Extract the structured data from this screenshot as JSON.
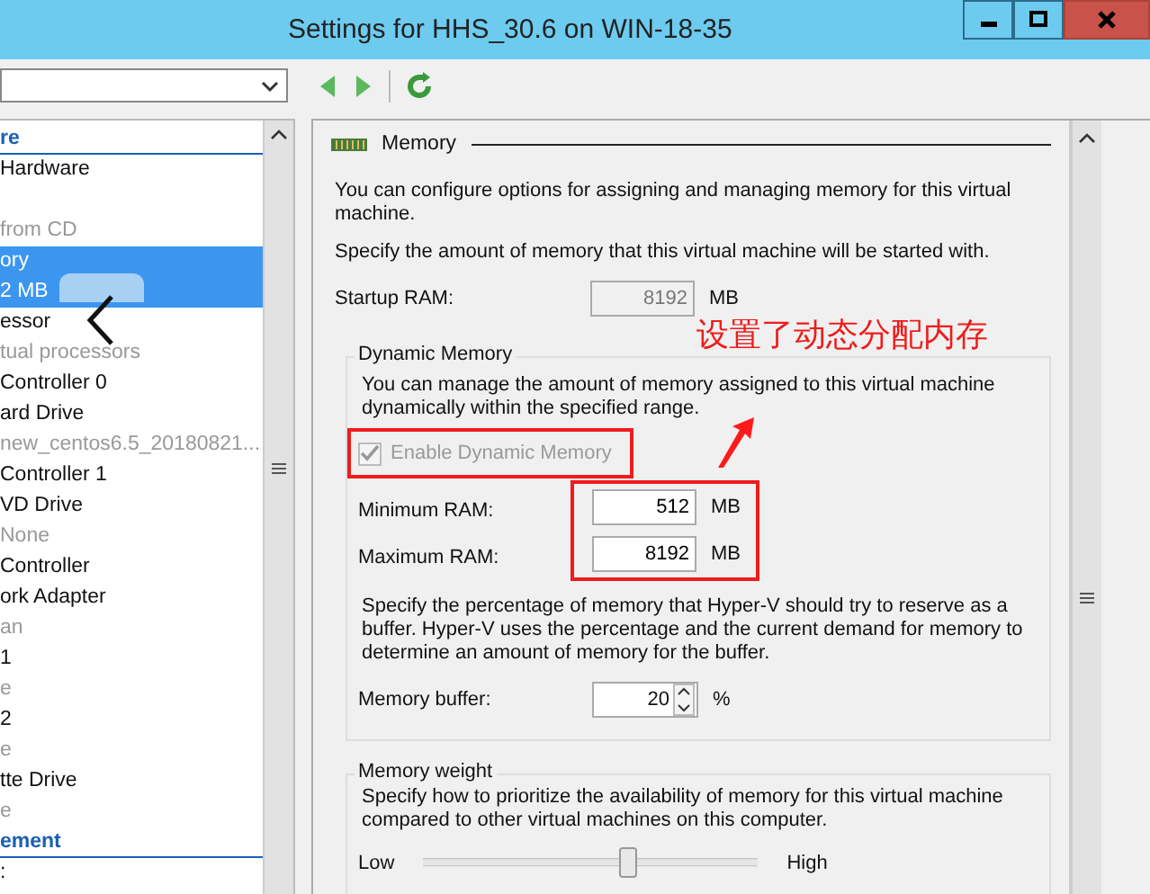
{
  "window": {
    "title": "Settings for HHS_30.6 on WIN-18-35"
  },
  "tree": [
    {
      "kind": "header",
      "label": "re",
      "selected": false
    },
    {
      "kind": "item",
      "label": "Hardware",
      "selected": false
    },
    {
      "kind": "blank",
      "selected": false
    },
    {
      "kind": "sub",
      "label": " from CD",
      "selected": false
    },
    {
      "kind": "item",
      "label": "ory",
      "selected": true
    },
    {
      "kind": "item",
      "label": "2 MB",
      "selected": true
    },
    {
      "kind": "item",
      "label": "essor",
      "selected": false
    },
    {
      "kind": "sub",
      "label": "tual processors",
      "selected": false
    },
    {
      "kind": "item",
      "label": "Controller 0",
      "selected": false
    },
    {
      "kind": "item",
      "label": "ard Drive",
      "selected": false
    },
    {
      "kind": "sub",
      "label": "new_centos6.5_20180821...",
      "selected": false
    },
    {
      "kind": "item",
      "label": "Controller 1",
      "selected": false
    },
    {
      "kind": "item",
      "label": "VD Drive",
      "selected": false
    },
    {
      "kind": "sub",
      "label": "None",
      "selected": false
    },
    {
      "kind": "item",
      "label": "Controller",
      "selected": false
    },
    {
      "kind": "item",
      "label": "ork Adapter",
      "selected": false
    },
    {
      "kind": "sub",
      "label": "an",
      "selected": false
    },
    {
      "kind": "item",
      "label": "1",
      "selected": false
    },
    {
      "kind": "sub",
      "label": "e",
      "selected": false
    },
    {
      "kind": "item",
      "label": "2",
      "selected": false
    },
    {
      "kind": "sub",
      "label": "e",
      "selected": false
    },
    {
      "kind": "item",
      "label": "tte Drive",
      "selected": false
    },
    {
      "kind": "sub",
      "label": "e",
      "selected": false
    },
    {
      "kind": "header",
      "label": "ement",
      "selected": false
    },
    {
      "kind": "item",
      "label": ":",
      "selected": false
    }
  ],
  "memory": {
    "title": "Memory",
    "intro": "You can configure options for assigning and managing memory for this virtual machine.",
    "startup_hint": "Specify the amount of memory that this virtual machine will be started with.",
    "startup_label": "Startup RAM:",
    "startup_value": "8192",
    "startup_unit": "MB",
    "dynamic": {
      "title": "Dynamic Memory",
      "text": "You can manage the amount of memory assigned to this virtual machine dynamically within the specified range.",
      "checkbox": {
        "label": "Enable Dynamic Memory",
        "checked": true,
        "disabled": true
      },
      "fields": [
        {
          "label": "Minimum RAM:",
          "value": "512",
          "unit": "MB"
        },
        {
          "label": "Maximum RAM:",
          "value": "8192",
          "unit": "MB"
        }
      ],
      "buffer_text": "Specify the percentage of memory that Hyper-V should try to reserve as a buffer. Hyper-V uses the percentage and the current demand for memory to determine an amount of memory for the buffer.",
      "buffer_label": "Memory buffer:",
      "buffer_value": "20",
      "buffer_unit": "%"
    },
    "weight": {
      "title": "Memory weight",
      "text": "Specify how to prioritize the availability of memory for this virtual machine compared to other virtual machines on this computer.",
      "low": "Low",
      "high": "High",
      "level": 0.61
    }
  },
  "annotation": {
    "text": "设置了动态分配内存"
  }
}
